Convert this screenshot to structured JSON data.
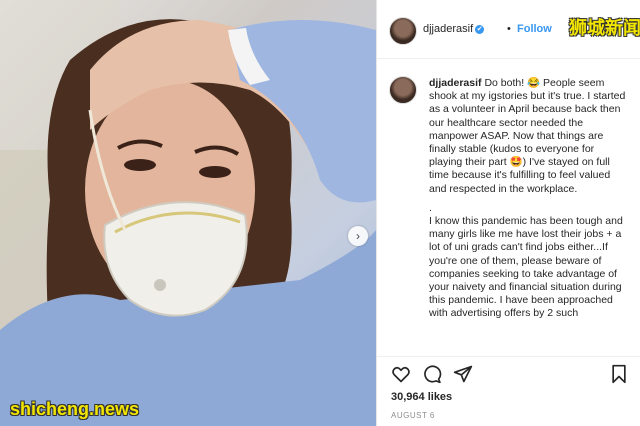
{
  "post": {
    "username": "djjaderasif",
    "verified_badge": "✔",
    "dot": "•",
    "follow_label": "Follow",
    "caption_user": "djjaderasif",
    "caption_p1": "Do both! 😂 People seem shook at my igstories but it's true. I started as a volunteer in April because back then our healthcare sector needed the manpower ASAP. Now that things are finally stable (kudos to everyone for playing their part 🤩) I've stayed on full time because it's fulfilling to feel valued and respected in the workplace.",
    "caption_sep": ".",
    "caption_p2": "I know this pandemic has been tough and many girls like me have lost their jobs + a lot of uni grads can't find jobs either...If you're one of them, please beware of companies seeking to take advantage of your naivety and financial situation during this pandemic. I have been approached with advertising offers by 2 such",
    "likes": "30,964 likes",
    "date": "AUGUST 6"
  },
  "watermarks": {
    "top_right": "狮城新闻",
    "bottom_left": "shicheng.news"
  },
  "icons": {
    "carousel_next": "chevron-right-icon",
    "like": "heart-icon",
    "comment": "comment-icon",
    "share": "paper-plane-icon",
    "save": "bookmark-icon"
  },
  "colors": {
    "accent": "#3897f0",
    "watermark": "#f2e500",
    "text": "#262626",
    "muted": "#8e8e8e"
  }
}
